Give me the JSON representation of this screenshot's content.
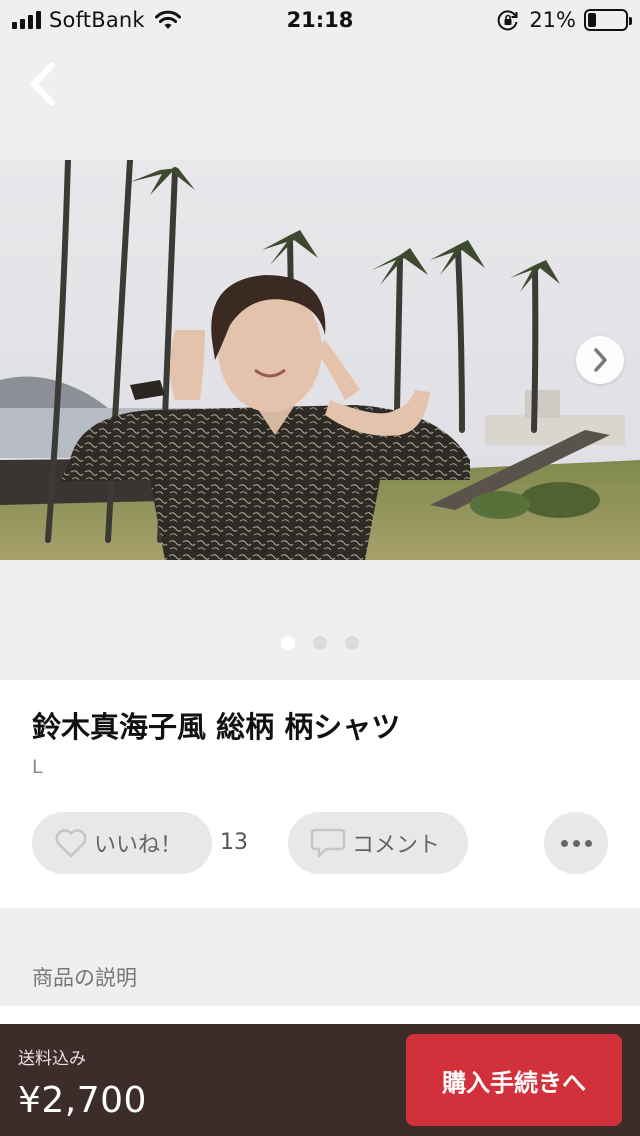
{
  "status_bar": {
    "carrier": "SoftBank",
    "time": "21:18",
    "battery_percent": "21%",
    "battery_level": 0.21,
    "icons": [
      "signal-icon",
      "wifi-icon",
      "rotation-lock-icon",
      "battery-icon"
    ]
  },
  "header": {
    "back_icon": "chevron-left-icon"
  },
  "gallery": {
    "image_count": 3,
    "active_index": 0,
    "next_icon": "chevron-right-icon"
  },
  "product": {
    "title": "鈴木真海子風 総柄 柄シャツ",
    "size": "L"
  },
  "actions": {
    "like_label": "いいね！",
    "like_count": "13",
    "comment_label": "コメント",
    "like_icon": "heart-icon",
    "comment_icon": "comment-icon",
    "more_icon": "more-icon"
  },
  "description": {
    "heading": "商品の説明"
  },
  "purchase": {
    "shipping_label": "送料込み",
    "price": "¥2,700",
    "buy_label": "購入手続きへ"
  },
  "colors": {
    "background": "#efefef",
    "purchase_bar": "#3d2d2a",
    "buy_button": "#d2303a",
    "pill": "#e8e8e8"
  }
}
